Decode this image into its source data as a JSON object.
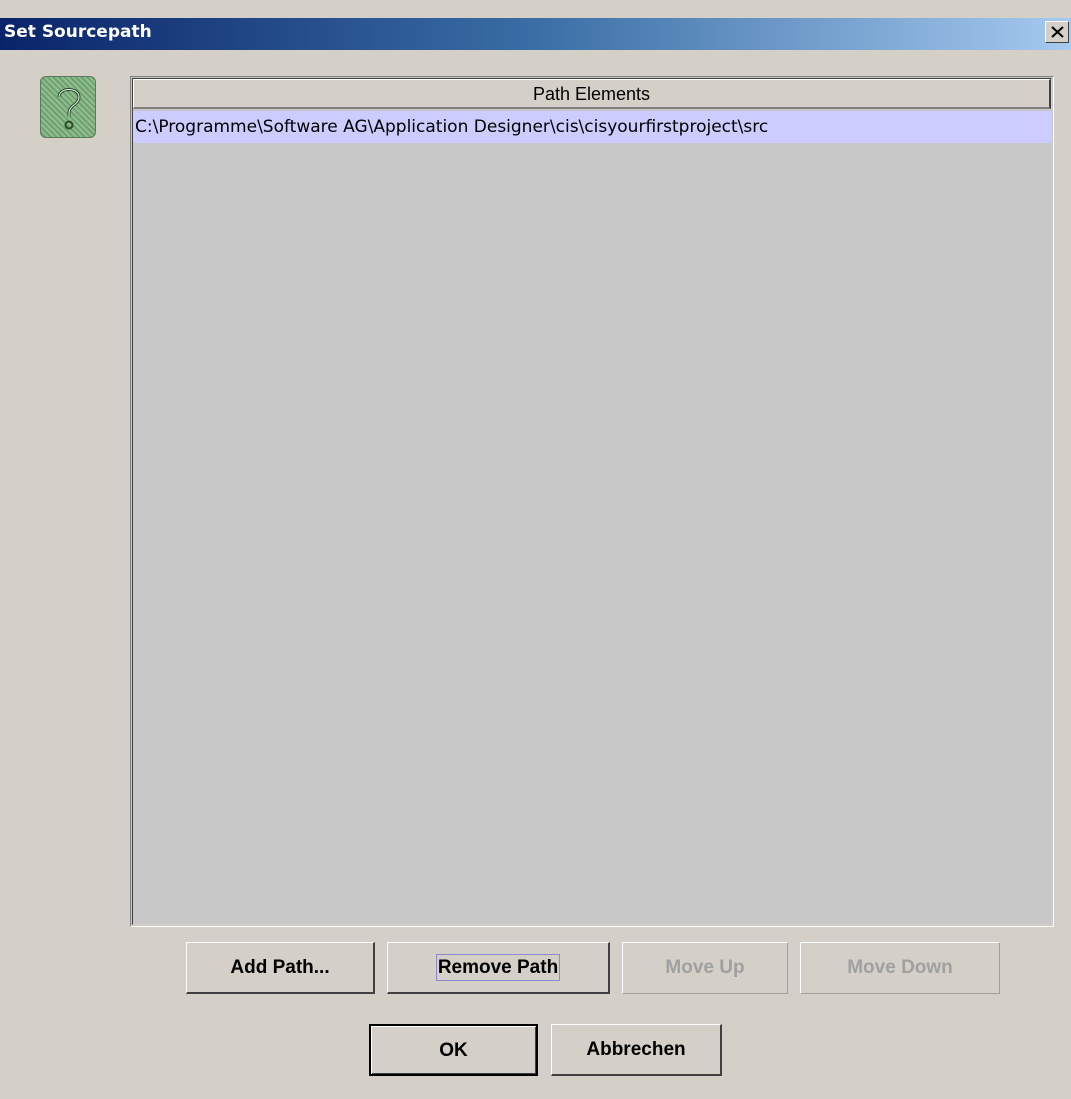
{
  "window": {
    "title": "Set Sourcepath",
    "close_icon": "close-icon"
  },
  "icon": {
    "name": "help-question-icon"
  },
  "table": {
    "columns": [
      "Path Elements"
    ],
    "rows": [
      "C:\\Programme\\Software AG\\Application Designer\\cis\\cisyourfirstproject\\src"
    ]
  },
  "buttons": {
    "add_path": "Add Path...",
    "remove_path": "Remove Path",
    "move_up": "Move Up",
    "move_down": "Move Down",
    "ok": "OK",
    "cancel": "Abbrechen"
  }
}
